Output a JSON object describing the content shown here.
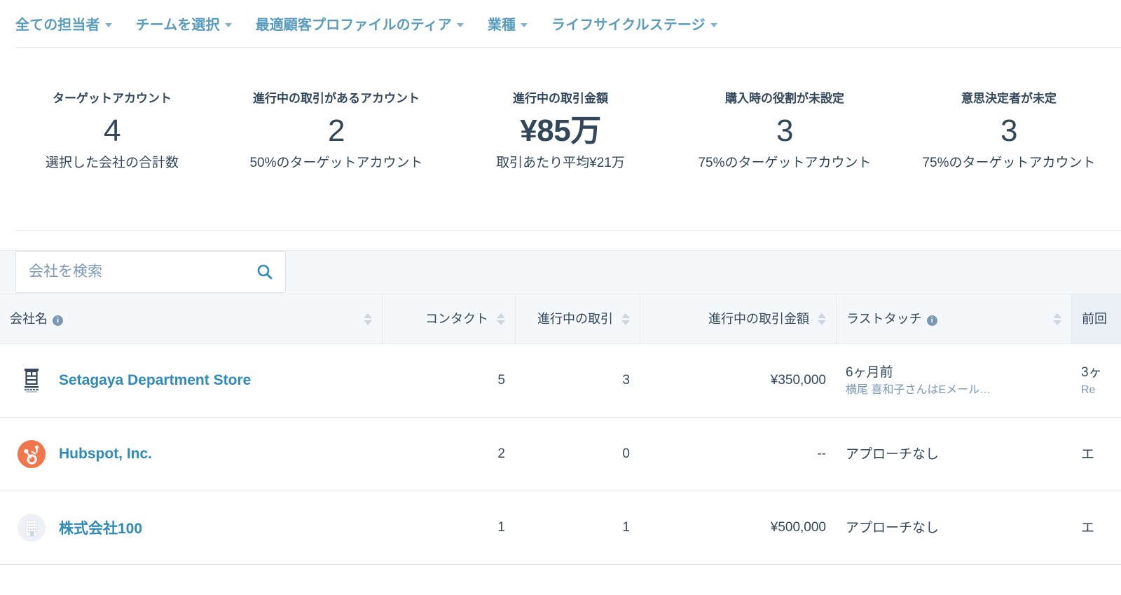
{
  "colors": {
    "link": "#5a9cbd",
    "company_link": "#2e8ab8",
    "text": "#33475b",
    "muted": "#7c98b6",
    "header_bg": "#f5f8fa",
    "border": "#e5e9f0",
    "hubspot_orange": "#f2754c"
  },
  "filters": [
    {
      "label": "全ての担当者",
      "icon": "chevron-down-icon"
    },
    {
      "label": "チームを選択",
      "icon": "chevron-down-icon"
    },
    {
      "label": "最適顧客プロファイルのティア",
      "icon": "chevron-down-icon"
    },
    {
      "label": "業種",
      "icon": "chevron-down-icon"
    },
    {
      "label": "ライフサイクルステージ",
      "icon": "chevron-down-icon"
    }
  ],
  "stats": [
    {
      "label": "ターゲットアカウント",
      "value": "4",
      "sub": "選択した会社の合計数"
    },
    {
      "label": "進行中の取引があるアカウント",
      "value": "2",
      "sub": "50%のターゲットアカウント"
    },
    {
      "label": "進行中の取引金額",
      "value": "¥85万",
      "sub": "取引あたり平均¥21万"
    },
    {
      "label": "購入時の役割が未設定",
      "value": "3",
      "sub": "75%のターゲットアカウント"
    },
    {
      "label": "意思決定者が未定",
      "value": "3",
      "sub": "75%のターゲットアカウント"
    }
  ],
  "search": {
    "placeholder": "会社を検索",
    "value": "",
    "icon": "search-icon"
  },
  "table": {
    "columns": [
      {
        "label": "会社名",
        "info": true,
        "align": "left",
        "sortable": true,
        "hovered": false
      },
      {
        "label": "コンタクト",
        "info": false,
        "align": "right",
        "sortable": true,
        "hovered": false
      },
      {
        "label": "進行中の取引",
        "info": false,
        "align": "right",
        "sortable": true,
        "hovered": false
      },
      {
        "label": "進行中の取引金額",
        "info": false,
        "align": "right",
        "sortable": true,
        "hovered": false
      },
      {
        "label": "ラストタッチ",
        "info": true,
        "align": "left",
        "sortable": true,
        "hovered": false
      },
      {
        "label": "前回",
        "info": false,
        "align": "left",
        "sortable": false,
        "hovered": true
      }
    ],
    "rows": [
      {
        "logo": "setagaya-department-store-logo",
        "company": "Setagaya Department Store",
        "contacts": "5",
        "open_deals": "3",
        "open_amount": "¥350,000",
        "last_touch_main": "6ヶ月前",
        "last_touch_sub": "横尾 喜和子さんはEメール…",
        "next_main": "3ヶ",
        "next_sub": "Re"
      },
      {
        "logo": "hubspot-logo",
        "company": "Hubspot, Inc.",
        "contacts": "2",
        "open_deals": "0",
        "open_amount": "--",
        "last_touch_main": "アプローチなし",
        "last_touch_sub": "",
        "next_main": "エ",
        "next_sub": ""
      },
      {
        "logo": "generic-company-logo",
        "company": "株式会社100",
        "contacts": "1",
        "open_deals": "1",
        "open_amount": "¥500,000",
        "last_touch_main": "アプローチなし",
        "last_touch_sub": "",
        "next_main": "エ",
        "next_sub": ""
      }
    ]
  }
}
